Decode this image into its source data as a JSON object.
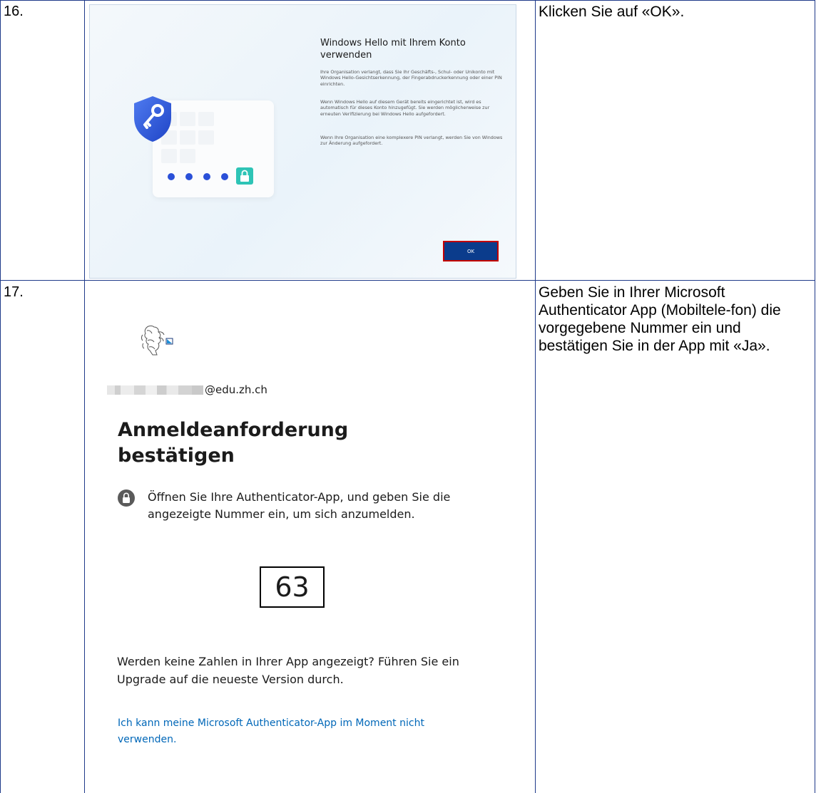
{
  "rows": [
    {
      "number": "16.",
      "instruction": "Klicken Sie auf «OK».",
      "screenshot": {
        "heading": "Windows Hello mit Ihrem Konto verwenden",
        "paragraphs": [
          "Ihre Organisation verlangt, dass Sie Ihr Geschäfts-, Schul- oder Unikonto mit Windows Hello-Gesichtserkennung, der Fingerabdruckerkennung oder einer PIN einrichten.",
          "Wenn Windows Hello auf diesem Gerät bereits eingerichtet ist, wird es automatisch für dieses Konto hinzugefügt. Sie werden möglicherweise zur erneuten Verifizierung bei Windows Hello aufgefordert.",
          "Wenn Ihre Organisation eine komplexere PIN verlangt, werden Sie von Windows zur Änderung aufgefordert."
        ],
        "ok_label": "OK",
        "colors": {
          "shield": "#2d5be3",
          "lock": "#2ec4b6",
          "pin_dots": "#2a50d8",
          "ok_button": "#0b3c8c",
          "highlight": "#c40000"
        }
      }
    },
    {
      "number": "17.",
      "instruction": "Geben Sie in Ihrer Microsoft Authenticator App (Mobiltele-fon) die vorgegebene Nummer ein und bestätigen Sie in der App mit «Ja».",
      "screenshot": {
        "email_suffix": "@edu.zh.ch",
        "title": "Anmeldeanforderung bestätigen",
        "info": "Öffnen Sie Ihre Authenticator-App, und geben Sie die angezeigte Nummer ein, um sich anzumelden.",
        "number": "63",
        "hint": "Werden keine Zahlen in Ihrer App angezeigt? Führen Sie ein Upgrade auf die neueste Version durch.",
        "link": "Ich kann meine Microsoft Authenticator-App im Moment nicht verwenden.",
        "colors": {
          "link": "#0067b8",
          "text": "#1b1b1b"
        }
      }
    }
  ]
}
